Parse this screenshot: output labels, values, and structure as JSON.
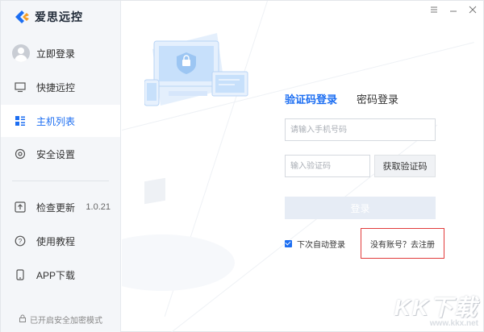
{
  "app": {
    "title": "爱思远控"
  },
  "sidebar": {
    "login_label": "立即登录",
    "items": [
      {
        "label": "快捷远控",
        "icon": "monitor-icon"
      },
      {
        "label": "主机列表",
        "icon": "host-list-icon"
      },
      {
        "label": "安全设置",
        "icon": "shield-settings-icon"
      }
    ],
    "bottom_items": [
      {
        "label": "检查更新",
        "icon": "update-icon",
        "version": "1.0.21"
      },
      {
        "label": "使用教程",
        "icon": "help-icon"
      },
      {
        "label": "APP下载",
        "icon": "phone-icon"
      }
    ],
    "footer_note": "已开启安全加密模式"
  },
  "login": {
    "tabs": [
      "验证码登录",
      "密码登录"
    ],
    "phone_placeholder": "请输入手机号码",
    "code_placeholder": "输入验证码",
    "get_code_label": "获取验证码",
    "submit_label": "登录",
    "auto_login_label": "下次自动登录",
    "register_link": "没有账号？去注册"
  },
  "watermark": {
    "main": "KK下载",
    "sub": "www.kkx.net"
  },
  "colors": {
    "accent": "#1c6ef2",
    "highlight_box": "#e23b3b"
  }
}
